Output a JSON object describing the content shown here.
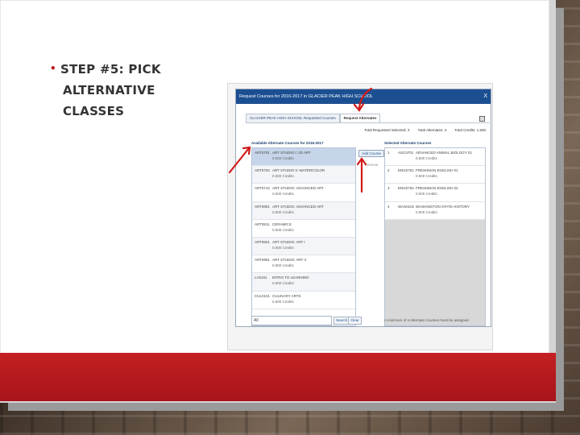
{
  "slide": {
    "bullet": "•",
    "heading_line1": "STEP #5: PICK",
    "heading_line2": "ALTERNATIVE CLASSES"
  },
  "dialog": {
    "title": "Request Courses for 2016-2017 in GLACIER PEAK HIGH SCHOOL",
    "close": "X",
    "tabs": [
      {
        "label": "GLACIER PEAK HIGH SCHOOL Requested Courses",
        "active": false
      },
      {
        "label": "Request Alternates",
        "active": true
      }
    ],
    "available_title": "Available Alternate Courses for 2016-2017",
    "selected_title": "Selected Alternate Courses",
    "stats": {
      "total_requested": "Total Requested Selected: 3",
      "total_alternates": "Total Alternates: 4",
      "total_credits": "Total Credits: 1.500"
    },
    "add_button": "Add Course",
    "remove_button": "Remove",
    "available_courses": [
      {
        "code": "ART0701",
        "name": "ART STUDIO I: 2D ART",
        "credits": "0.500 Credits",
        "selected": true
      },
      {
        "code": "ART0702",
        "name": "ART STUDIO II: WATERCOLOR",
        "credits": "0.500 Credits",
        "selected": false
      },
      {
        "code": "ART0712",
        "name": "ART STUDIO: ADVANCED ART",
        "credits": "0.500 Credits",
        "selected": false
      },
      {
        "code": "ART0801",
        "name": "ART STUDIO: ADVANCED ART",
        "credits": "0.500 Credits",
        "selected": false
      },
      {
        "code": "ART0811",
        "name": "CERAMICS",
        "credits": "0.500 Credits",
        "selected": false
      },
      {
        "code": "ART0821",
        "name": "ART STUDIO: ART I",
        "credits": "0.500 Credits",
        "selected": false
      },
      {
        "code": "ART0901",
        "name": "ART STUDIO: ART II",
        "credits": "0.500 Credits",
        "selected": false
      },
      {
        "code": "LA0101",
        "name": "INTRO TO LEARNING",
        "credits": "0.500 Credits",
        "selected": false
      },
      {
        "code": "CUL0101",
        "name": "CULINARY ARTS",
        "credits": "0.500 Credits",
        "selected": false
      }
    ],
    "selected_courses": [
      {
        "priority": "1",
        "code": "ASC0701",
        "name": "ADVANCED ANIMAL BIOLOGY 01",
        "credits": "0.500 Credits"
      },
      {
        "priority": "2",
        "code": "ENG0701",
        "name": "FRESHMAN ENGLISH 01",
        "credits": "0.500 Credits"
      },
      {
        "priority": "3",
        "code": "ENG0702",
        "name": "FRESHMAN ENGLISH 02",
        "credits": "0.500 Credits"
      },
      {
        "priority": "4",
        "code": "WAS0101",
        "name": "WASHINGTON STATE HISTORY",
        "credits": "0.500 Credits"
      }
    ],
    "search_value": "All",
    "search_button": "Search",
    "clear_button": "Clear",
    "footnote": "A minimum of 4 Alternate Courses must be assigned."
  },
  "colors": {
    "accent_red": "#b5171c",
    "dialog_blue": "#1c4f92",
    "annotation_red": "#d11a1a"
  }
}
